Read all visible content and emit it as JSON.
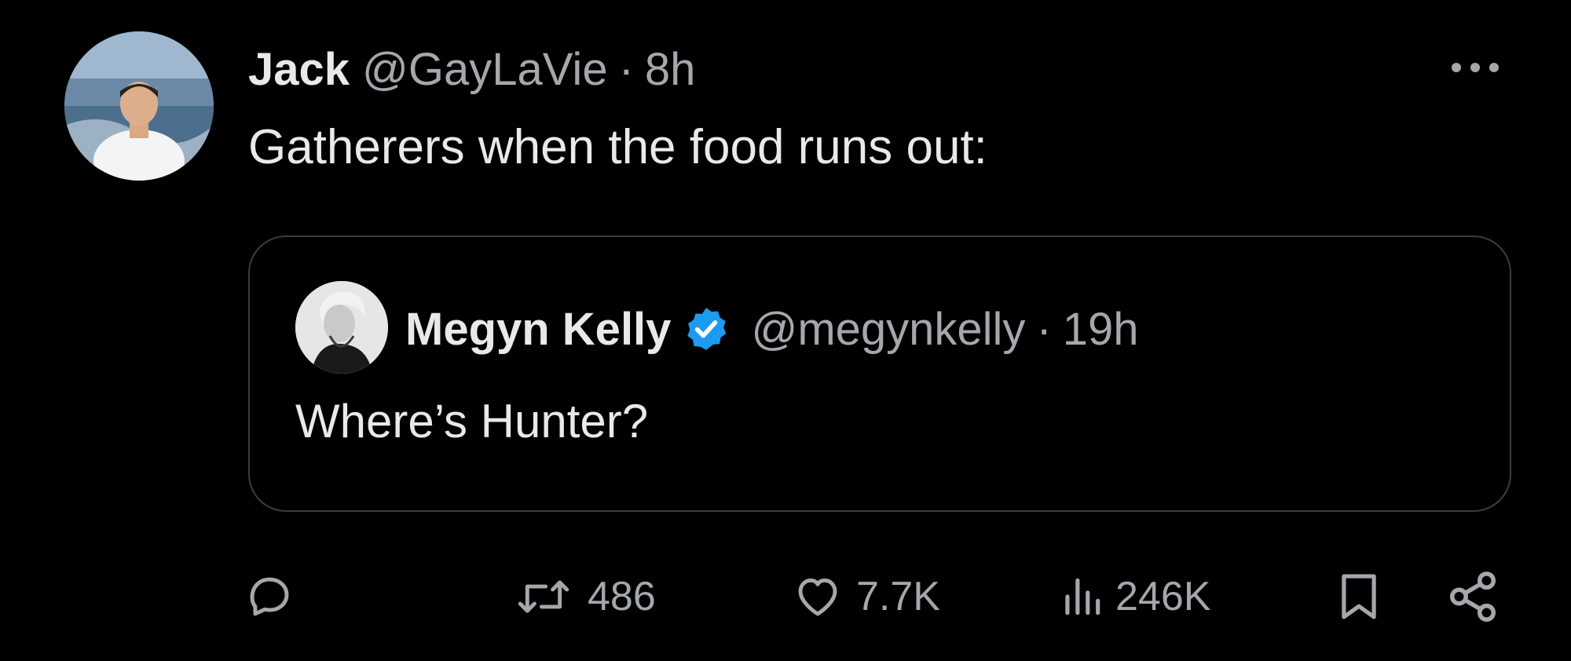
{
  "tweet": {
    "author_name": "Jack",
    "author_handle": "@GayLaVie",
    "separator": "·",
    "time": "8h",
    "text": "Gatherers when the food runs out:",
    "more_icon": "more-horizontal-icon"
  },
  "quote": {
    "author_name": "Megyn Kelly",
    "verified_icon": "verified-badge-icon",
    "author_handle": "@megynkelly",
    "separator": "·",
    "time": "19h",
    "text": "Where’s Hunter?"
  },
  "actions": {
    "reply": {
      "icon": "reply-icon",
      "count": ""
    },
    "retweet": {
      "icon": "retweet-icon",
      "count": "486"
    },
    "like": {
      "icon": "heart-icon",
      "count": "7.7K"
    },
    "views": {
      "icon": "views-icon",
      "count": "246K"
    },
    "bookmark": {
      "icon": "bookmark-icon"
    },
    "share": {
      "icon": "share-icon"
    }
  },
  "colors": {
    "background": "#000000",
    "primary_text": "#e7e9ea",
    "secondary_text": "#a4a8ac",
    "border": "#3a3d41",
    "verified_blue": "#1d9bf0"
  }
}
